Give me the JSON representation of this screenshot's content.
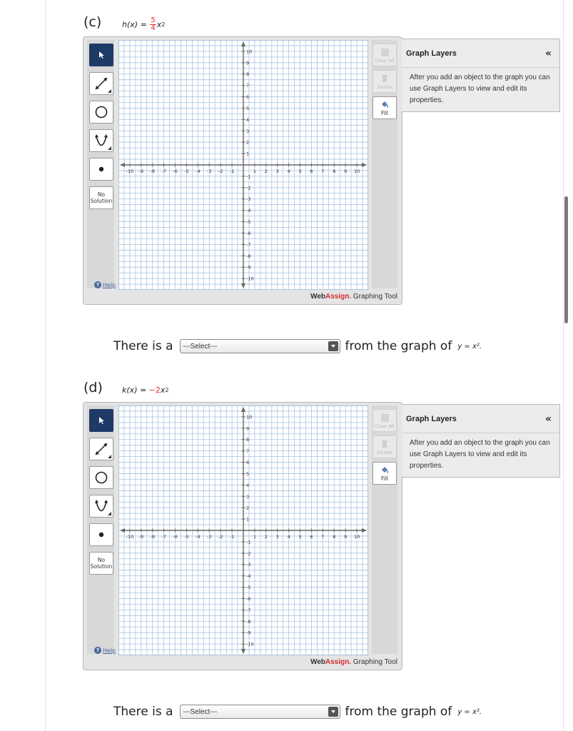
{
  "parts": [
    {
      "label": "(c)",
      "func_name": "h",
      "func_var": "x",
      "coef_num": "5",
      "coef_den": "4",
      "coef_sign": "",
      "power": "2"
    },
    {
      "label": "(d)",
      "func_name": "k",
      "func_var": "x",
      "coef_text": "−2",
      "power": "2"
    }
  ],
  "tool": {
    "no_solution_line1": "No",
    "no_solution_line2": "Solution",
    "help": "Help",
    "clear_all": "Clear All",
    "delete": "Delete",
    "fill": "Fill",
    "brand_web": "Web",
    "brand_assign": "Assign.",
    "brand_suffix": "Graphing Tool",
    "x_ticks": [
      "-10",
      "-9",
      "-8",
      "-7",
      "-6",
      "-5",
      "-4",
      "-3",
      "-2",
      "-1",
      "1",
      "2",
      "3",
      "4",
      "5",
      "6",
      "7",
      "8",
      "9",
      "10"
    ],
    "y_ticks": [
      "10",
      "9",
      "8",
      "7",
      "6",
      "5",
      "4",
      "3",
      "2",
      "1",
      "-1",
      "-2",
      "-3",
      "-4",
      "-5",
      "-6",
      "-7",
      "-8",
      "-9",
      "-10"
    ],
    "axis_range": [
      -11,
      11
    ]
  },
  "layers": {
    "title": "Graph Layers",
    "collapse": "«",
    "body": "After you add an object to the graph you can use Graph Layers to view and edit its properties."
  },
  "answer": {
    "prefix": "There is a",
    "select_value": "---Select---",
    "middle": "from the graph of",
    "ref_equation": "y = x²."
  },
  "colors": {
    "grid": "#a9c4e0",
    "accent_red": "#e5302b",
    "active_tool": "#1e3a66"
  }
}
